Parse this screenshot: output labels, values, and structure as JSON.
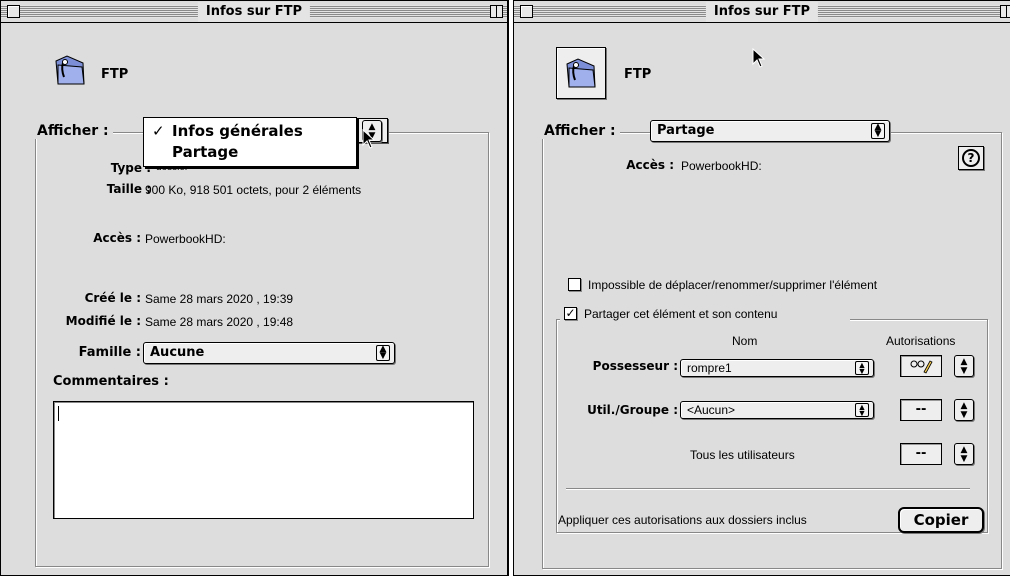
{
  "left_window": {
    "title": "Infos sur FTP",
    "item_name": "FTP",
    "show_label": "Afficher :",
    "show_menu": {
      "items": [
        "Infos générales",
        "Partage"
      ],
      "selected": "Infos générales"
    },
    "type_label": "Type :",
    "type_value": "dossier",
    "size_label": "Taille :",
    "size_value": "900  Ko, 918 501 octets, pour 2 éléments",
    "access_label": "Accès :",
    "access_value": "PowerbookHD:",
    "created_label": "Créé le :",
    "created_value": "Same 28 mars 2020 , 19:39",
    "modified_label": "Modifié le :",
    "modified_value": "Same 28 mars 2020 , 19:48",
    "family_label": "Famille :",
    "family_value": "Aucune",
    "comments_label": "Commentaires :",
    "comments_value": ""
  },
  "right_window": {
    "title": "Infos sur FTP",
    "item_name": "FTP",
    "show_label": "Afficher :",
    "show_value": "Partage",
    "access_label": "Accès :",
    "access_value": "PowerbookHD:",
    "help_label": "?",
    "lock_checkbox": {
      "label": "Impossible de déplacer/renommer/supprimer l'élément",
      "checked": false
    },
    "share_checkbox": {
      "label": "Partager cet élément et son contenu",
      "checked": true
    },
    "col_name": "Nom",
    "col_permissions": "Autorisations",
    "owner_label": "Possesseur :",
    "owner_value": "rompre1",
    "group_label": "Util./Groupe :",
    "group_value": "<Aucun>",
    "group_perm": "--",
    "everyone_label": "Tous les utilisateurs",
    "everyone_perm": "--",
    "apply_label": "Appliquer ces autorisations aux dossiers inclus",
    "copy_button": "Copier"
  }
}
